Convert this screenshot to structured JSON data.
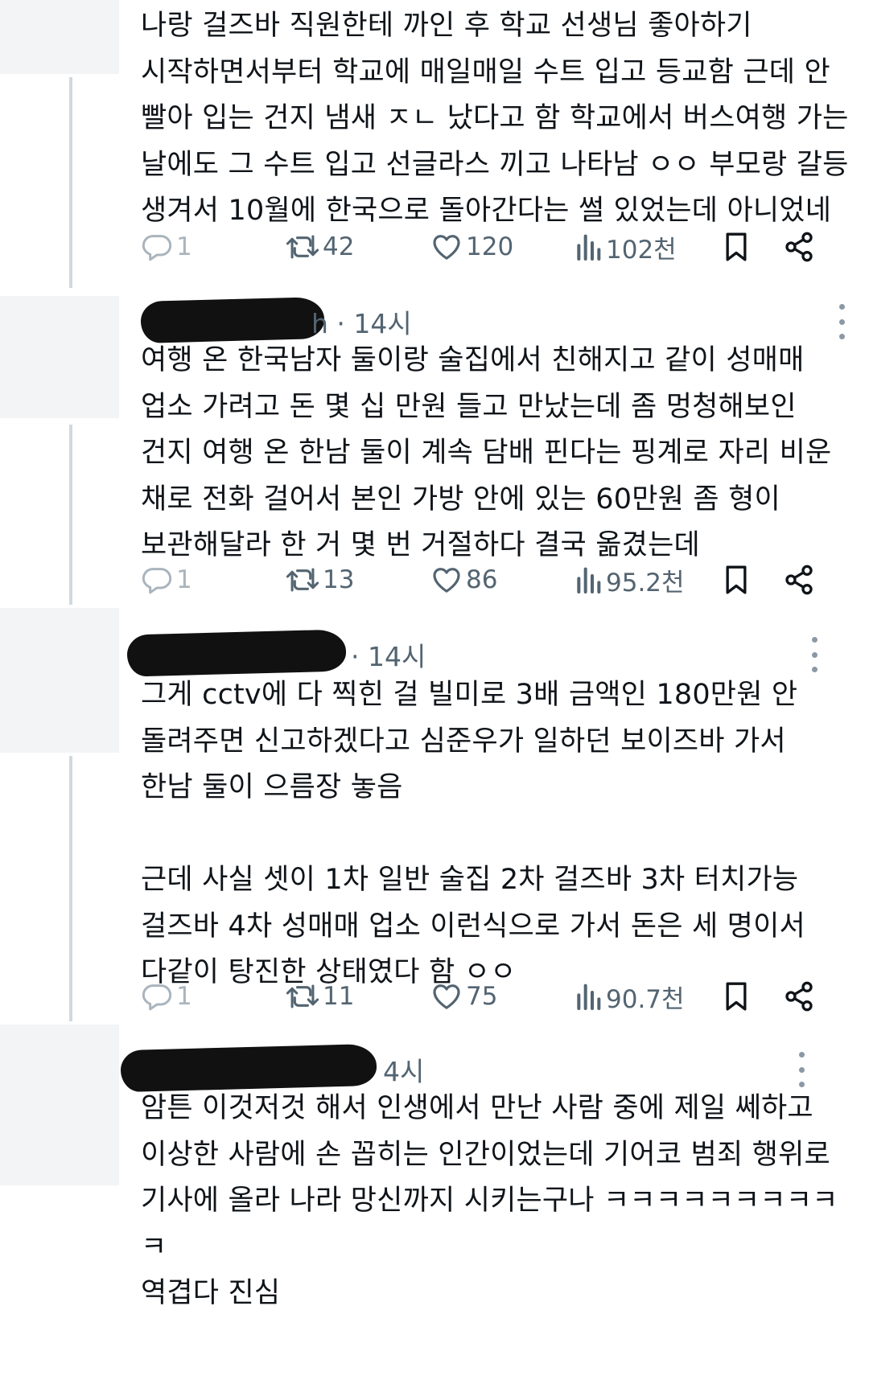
{
  "posts": [
    {
      "author_visible": "",
      "time": "",
      "show_header": false,
      "body": "나랑 걸즈바 직원한테 까인 후 학교 선생님 좋아하기\n시작하면서부터 학교에 매일매일 수트 입고 등교함 근데 안\n빨아 입는 건지 냄새 ㅈㄴ 났다고 함 학교에서 버스여행 가는\n날에도 그 수트 입고 선글라스 끼고 나타남 ㅇㅇ 부모랑 갈등\n생겨서 10월에 한국으로 돌아간다는 썰 있었는데 아니었네",
      "replies": "1",
      "reposts": "42",
      "likes": "120",
      "views": "102천"
    },
    {
      "author_visible": "h · 14시",
      "time": "14시",
      "show_header": true,
      "body": "여행 온 한국남자 둘이랑 술집에서 친해지고 같이 성매매\n업소 가려고 돈 몇 십 만원 들고 만났는데 좀 멍청해보인\n건지 여행 온 한남 둘이 계속 담배 핀다는 핑계로 자리 비운\n채로 전화 걸어서 본인 가방 안에 있는 60만원 좀 형이\n보관해달라 한 거 몇 번 거절하다 결국 옮겼는데",
      "replies": "1",
      "reposts": "13",
      "likes": "86",
      "views": "95.2천"
    },
    {
      "author_visible": "· 14시",
      "time": "14시",
      "show_header": true,
      "body": "그게 cctv에 다 찍힌 걸 빌미로 3배 금액인 180만원 안\n돌려주면 신고하겠다고 심준우가 일하던 보이즈바 가서\n한남 둘이 으름장 놓음\n\n근데 사실 셋이 1차 일반 술집 2차 걸즈바 3차 터치가능\n걸즈바 4차 성매매 업소 이런식으로 가서 돈은 세 명이서\n다같이 탕진한 상태였다 함 ㅇㅇ",
      "replies": "1",
      "reposts": "11",
      "likes": "75",
      "views": "90.7천"
    },
    {
      "author_visible": "4시",
      "time": "14시",
      "show_header": true,
      "body": "암튼 이것저것 해서 인생에서 만난 사람 중에 제일 쎄하고\n이상한 사람에 손 꼽히는 인간이었는데 기어코 범죄 행위로\n기사에 올라 나라 망신까지 시키는구나 ㅋㅋㅋㅋㅋㅋㅋㅋㅋㅋ\n역겹다 진심"
    }
  ],
  "icons": {
    "reply": "reply-icon",
    "repost": "repost-icon",
    "like": "heart-icon",
    "views": "views-icon",
    "bookmark": "bookmark-icon",
    "share": "share-icon",
    "more": "more-icon"
  },
  "colors": {
    "text": "#0f1419",
    "secondary": "#536471",
    "thread_line": "#cfd9de",
    "redaction": "#111111"
  }
}
